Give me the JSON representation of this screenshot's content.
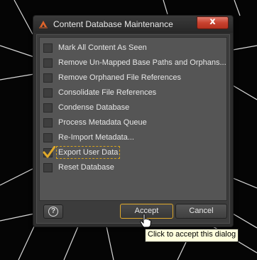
{
  "window": {
    "title": "Content Database Maintenance",
    "close_label": "x",
    "app_icon": "daz-logo-icon"
  },
  "options": [
    {
      "label": "Mark All Content As Seen",
      "checked": false
    },
    {
      "label": "Remove Un-Mapped Base Paths and Orphans...",
      "checked": false
    },
    {
      "label": "Remove Orphaned File References",
      "checked": false
    },
    {
      "label": "Consolidate File References",
      "checked": false
    },
    {
      "label": "Condense Database",
      "checked": false
    },
    {
      "label": "Process Metadata Queue",
      "checked": false
    },
    {
      "label": "Re-Import Metadata...",
      "checked": false
    },
    {
      "label": "Export User Data",
      "checked": true,
      "focused": true
    },
    {
      "label": "Reset Database",
      "checked": false
    }
  ],
  "buttons": {
    "help_label": "?",
    "accept_label": "Accept",
    "cancel_label": "Cancel"
  },
  "tooltip": {
    "text": "Click to accept this dialog"
  },
  "colors": {
    "accent": "#e0a92a",
    "close": "#c8422f",
    "panel": "#555555",
    "tooltip_bg": "#ffffdc"
  }
}
